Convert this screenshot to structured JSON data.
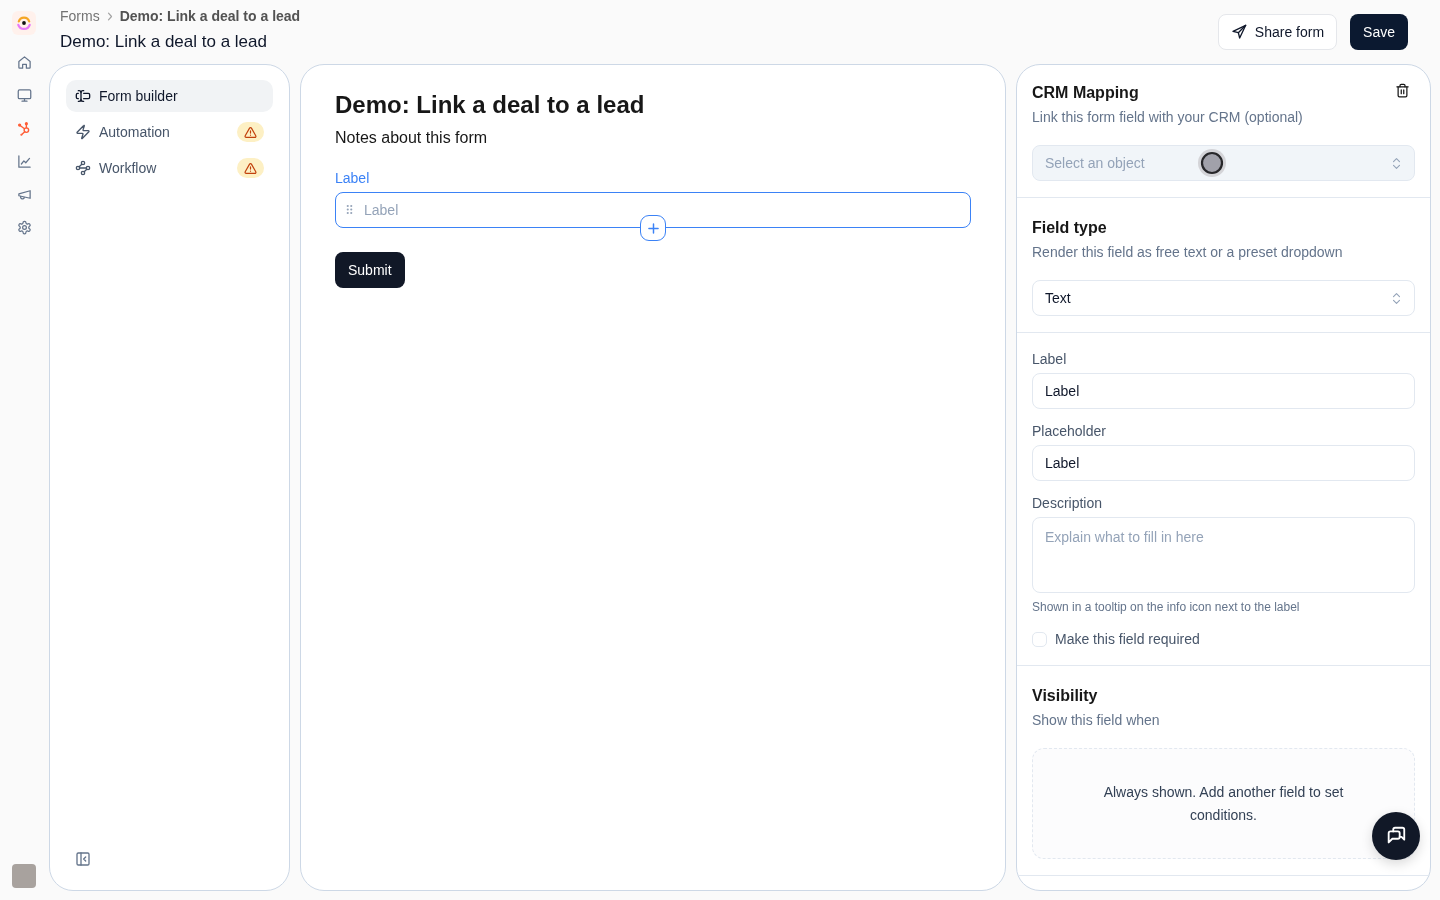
{
  "breadcrumb": [
    "Forms",
    "Demo: Link a deal to a lead"
  ],
  "page_title": "Demo: Link a deal to a lead",
  "share_button": {
    "label": "Share form"
  },
  "save_button": {
    "label": "Save"
  },
  "nav": {
    "items": [
      {
        "kind": "form",
        "label": "Form builder",
        "selected": true,
        "warning": false
      },
      {
        "kind": "automation",
        "label": "Automation",
        "selected": false,
        "warning": true
      },
      {
        "kind": "workflow",
        "label": "Workflow",
        "selected": false,
        "warning": true
      }
    ]
  },
  "form": {
    "title": "Demo: Link a deal to a lead",
    "notes": "Notes about this form",
    "fields": [
      {
        "label": "Label",
        "placeholder": "Label",
        "focused": true
      }
    ],
    "submit": "Submit"
  },
  "inspector": {
    "crm_mapping": {
      "title": "CRM Mapping",
      "subtitle": "Link this form field with your CRM (optional)",
      "select": {
        "placeholder": "Select an object",
        "disabled": true
      }
    },
    "field_type": {
      "title": "Field type",
      "subtitle": "Render this field as free text or a preset dropdown",
      "select": {
        "value": "Text",
        "disabled": false
      }
    },
    "settings": {
      "label_field": {
        "label": "Label",
        "value": "Label"
      },
      "placeholder_field": {
        "label": "Placeholder",
        "value": "Label"
      },
      "description_field": {
        "label": "Description",
        "placeholder": "Explain what to fill in here",
        "hint": "Shown in a tooltip on the info icon next to the label"
      },
      "required": {
        "label": "Make this field required",
        "checked": false
      }
    },
    "visibility": {
      "title": "Visibility",
      "subtitle": "Show this field when",
      "empty_message": "Always shown. Add another field to set conditions."
    }
  }
}
